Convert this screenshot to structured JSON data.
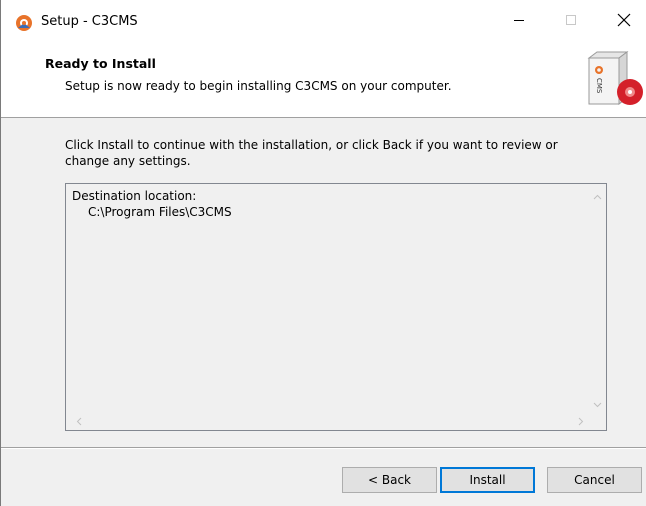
{
  "window": {
    "title": "Setup - C3CMS"
  },
  "header": {
    "title": "Ready to Install",
    "subtitle": "Setup is now ready to begin installing C3CMS on your computer.",
    "logo_text": "CMS"
  },
  "main": {
    "intro": "Click Install to continue with the installation, or click Back if you want to review or change any settings.",
    "memo": {
      "line1": "Destination location:",
      "line2": "C:\\Program Files\\C3CMS"
    }
  },
  "buttons": {
    "back": "< Back",
    "install": "Install",
    "cancel": "Cancel"
  },
  "colors": {
    "accent": "#0078d7",
    "logo_orange": "#e8732a",
    "disc_red": "#d4202a"
  }
}
